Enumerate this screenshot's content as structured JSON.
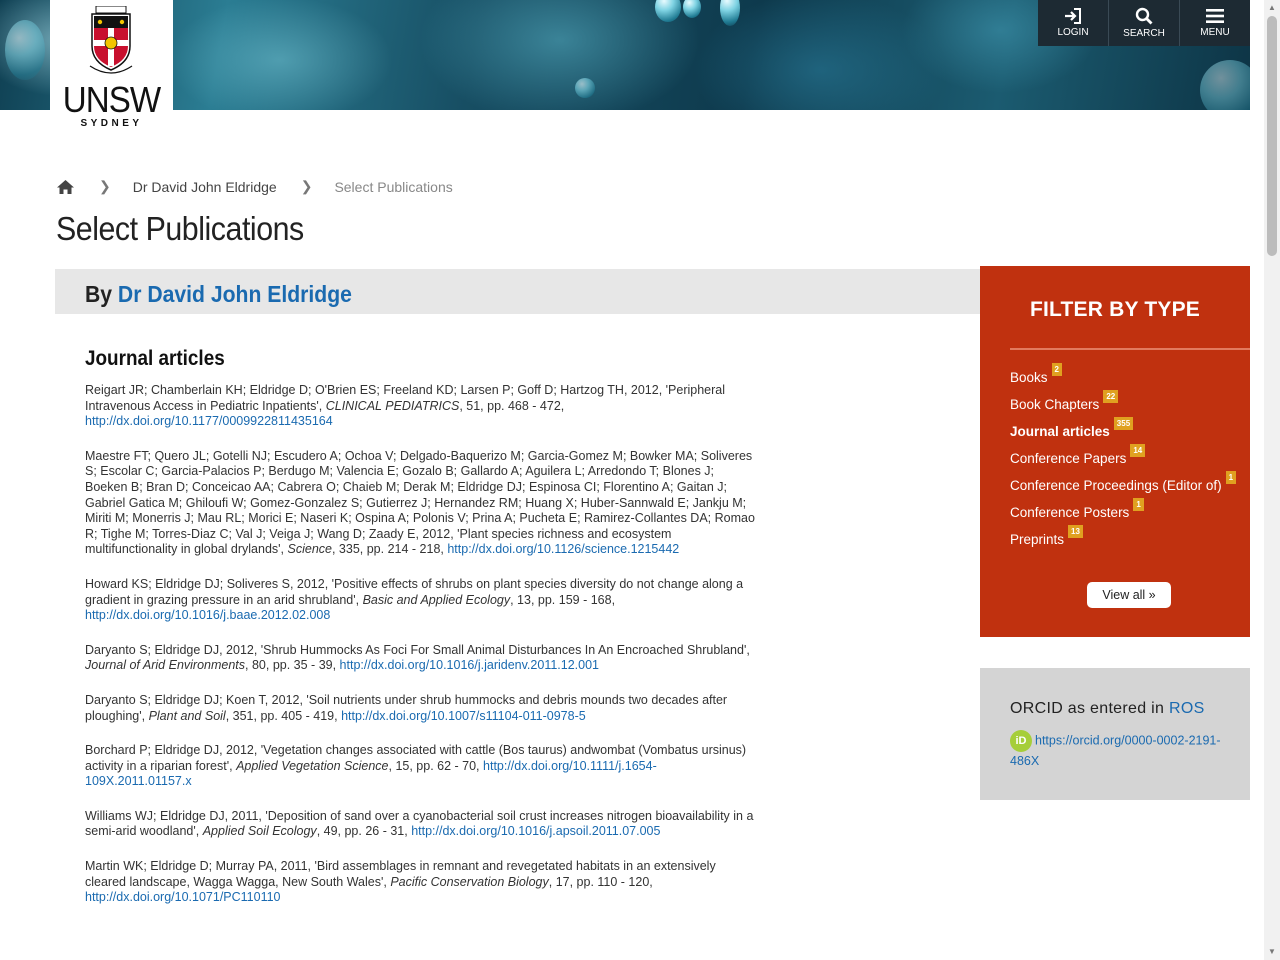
{
  "header": {
    "logo_text": "UNSW",
    "logo_subtext": "SYDNEY",
    "nav": [
      {
        "label": "LOGIN",
        "icon": "login-icon"
      },
      {
        "label": "SEARCH",
        "icon": "search-icon"
      },
      {
        "label": "MENU",
        "icon": "hamburger-menu-icon"
      }
    ]
  },
  "breadcrumb": {
    "home_icon": "home-icon",
    "items": [
      "Dr David John Eldridge",
      "Select Publications"
    ]
  },
  "page_title": "Select Publications",
  "author": {
    "prefix": "By",
    "name": "Dr David John Eldridge"
  },
  "section_title": "Journal articles",
  "publications": [
    {
      "authors_year": "Reigart JR; Chamberlain KH; Eldridge D; O'Brien ES; Freeland KD; Larsen P; Goff D; Hartzog TH, 2012, 'Peripheral Intravenous Access in Pediatric Inpatients', ",
      "journal": "CLINICAL PEDIATRICS",
      "details": ", 51, pp. 468 - 472, ",
      "doi": "http://dx.doi.org/10.1177/0009922811435164"
    },
    {
      "authors_year": "Maestre FT; Quero JL; Gotelli NJ; Escudero A; Ochoa V; Delgado-Baquerizo M; Garcia-Gomez M; Bowker MA; Soliveres S; Escolar C; Garcia-Palacios P; Berdugo M; Valencia E; Gozalo B; Gallardo A; Aguilera L; Arredondo T; Blones J; Boeken B; Bran D; Conceicao AA; Cabrera O; Chaieb M; Derak M; Eldridge DJ; Espinosa CI; Florentino A; Gaitan J; Gabriel Gatica M; Ghiloufi W; Gomez-Gonzalez S; Gutierrez J; Hernandez RM; Huang X; Huber-Sannwald E; Jankju M; Miriti M; Monerris J; Mau RL; Morici E; Naseri K; Ospina A; Polonis V; Prina A; Pucheta E; Ramirez-Collantes DA; Romao R; Tighe M; Torres-Diaz C; Val J; Veiga J; Wang D; Zaady E, 2012, 'Plant species richness and ecosystem multifunctionality in global drylands', ",
      "journal": "Science",
      "details": ", 335, pp. 214 - 218, ",
      "doi": "http://dx.doi.org/10.1126/science.1215442"
    },
    {
      "authors_year": "Howard KS; Eldridge DJ; Soliveres S, 2012, 'Positive effects of shrubs on plant species diversity do not change along a gradient in grazing pressure in an arid shrubland', ",
      "journal": "Basic and Applied Ecology",
      "details": ", 13, pp. 159 - 168, ",
      "doi": "http://dx.doi.org/10.1016/j.baae.2012.02.008"
    },
    {
      "authors_year": "Daryanto S; Eldridge DJ, 2012, 'Shrub Hummocks As Foci For Small Animal Disturbances In An Encroached Shrubland', ",
      "journal": "Journal of Arid Environments",
      "details": ", 80, pp. 35 - 39, ",
      "doi": "http://dx.doi.org/10.1016/j.jaridenv.2011.12.001"
    },
    {
      "authors_year": "Daryanto S; Eldridge DJ; Koen T, 2012, 'Soil nutrients under shrub hummocks and debris mounds two decades after ploughing', ",
      "journal": "Plant and Soil",
      "details": ", 351, pp. 405 - 419, ",
      "doi": "http://dx.doi.org/10.1007/s11104-011-0978-5"
    },
    {
      "authors_year": "Borchard P; Eldridge DJ, 2012, 'Vegetation changes associated with cattle (Bos taurus) andwombat (Vombatus ursinus) activity in a riparian forest', ",
      "journal": "Applied Vegetation Science",
      "details": ", 15, pp. 62 - 70, ",
      "doi": "http://dx.doi.org/10.1111/j.1654-109X.2011.01157.x"
    },
    {
      "authors_year": "Williams WJ; Eldridge DJ, 2011, 'Deposition of sand over a cyanobacterial soil crust increases nitrogen bioavailability in a semi-arid woodland', ",
      "journal": "Applied Soil Ecology",
      "details": ", 49, pp. 26 - 31, ",
      "doi": "http://dx.doi.org/10.1016/j.apsoil.2011.07.005"
    },
    {
      "authors_year": "Martin WK; Eldridge D; Murray PA, 2011, 'Bird assemblages in remnant and revegetated habitats in an extensively cleared landscape, Wagga Wagga, New South Wales', ",
      "journal": "Pacific Conservation Biology",
      "details": ", 17, pp. 110 - 120, ",
      "doi": "http://dx.doi.org/10.1071/PC110110"
    }
  ],
  "filter": {
    "title": "FILTER BY TYPE",
    "items": [
      {
        "label": "Books",
        "count": "2",
        "active": false
      },
      {
        "label": "Book Chapters",
        "count": "22",
        "active": false
      },
      {
        "label": "Journal articles",
        "count": "355",
        "active": true
      },
      {
        "label": "Conference Papers",
        "count": "14",
        "active": false
      },
      {
        "label": "Conference Proceedings (Editor of)",
        "count": "1",
        "active": false
      },
      {
        "label": "Conference Posters",
        "count": "1",
        "active": false
      },
      {
        "label": "Preprints",
        "count": "13",
        "active": false
      }
    ],
    "view_all": "View all »",
    "accent_color": "#c0310f",
    "badge_color": "#e0a020"
  },
  "orcid": {
    "heading_prefix": "ORCID as entered in",
    "heading_link": "ROS",
    "icon_text": "iD",
    "url": "https://orcid.org/0000-0002-2191-486X"
  }
}
